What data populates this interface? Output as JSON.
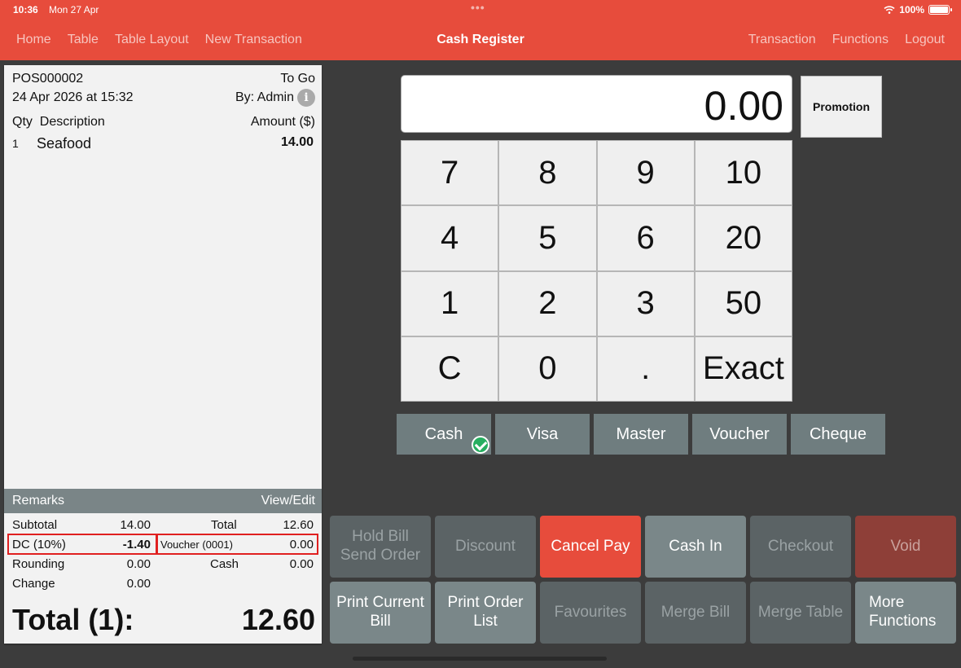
{
  "status": {
    "time": "10:36",
    "date": "Mon 27 Apr",
    "battery": "100%"
  },
  "nav": {
    "left": [
      "Home",
      "Table",
      "Table Layout",
      "New Transaction"
    ],
    "title": "Cash Register",
    "right": [
      "Transaction",
      "Functions",
      "Logout"
    ]
  },
  "receipt": {
    "order_no": "POS000002",
    "order_type": "To Go",
    "datetime": "24 Apr 2026 at 15:32",
    "by": "By: Admin",
    "hdr_qty": "Qty",
    "hdr_desc": "Description",
    "hdr_amount": "Amount ($)",
    "items": [
      {
        "qty": "1",
        "desc": "Seafood",
        "amount": "14.00"
      }
    ],
    "remarks": "Remarks",
    "view_edit": "View/Edit",
    "subtotal_label": "Subtotal",
    "subtotal": "14.00",
    "total_label": "Total",
    "total": "12.60",
    "dc_label": "DC (10%)",
    "dc": "-1.40",
    "voucher_label": "Voucher (0001)",
    "voucher": "0.00",
    "rounding_label": "Rounding",
    "rounding": "0.00",
    "cash_label": "Cash",
    "cash": "0.00",
    "change_label": "Change",
    "change": "0.00",
    "grand_label": "Total (1):",
    "grand": "12.60"
  },
  "display": {
    "value": "0.00",
    "promotion": "Promotion"
  },
  "keypad": [
    "7",
    "8",
    "9",
    "10",
    "4",
    "5",
    "6",
    "20",
    "1",
    "2",
    "3",
    "50",
    "C",
    "0",
    ".",
    "Exact"
  ],
  "payments": [
    "Cash",
    "Visa",
    "Master",
    "Voucher",
    "Cheque"
  ],
  "selected_payment": "Cash",
  "actions": {
    "hold": "Hold Bill\nSend Order",
    "discount": "Discount",
    "cancel_pay": "Cancel Pay",
    "cash_in": "Cash In",
    "checkout": "Checkout",
    "void": "Void",
    "print_bill": "Print Current Bill",
    "print_order": "Print Order List",
    "favourites": "Favourites",
    "merge_bill": "Merge Bill",
    "merge_table": "Merge Table",
    "more": "More Functions"
  },
  "colors": {
    "accent": "#e74c3c",
    "button": "#7a8789",
    "success": "#27ae60"
  }
}
